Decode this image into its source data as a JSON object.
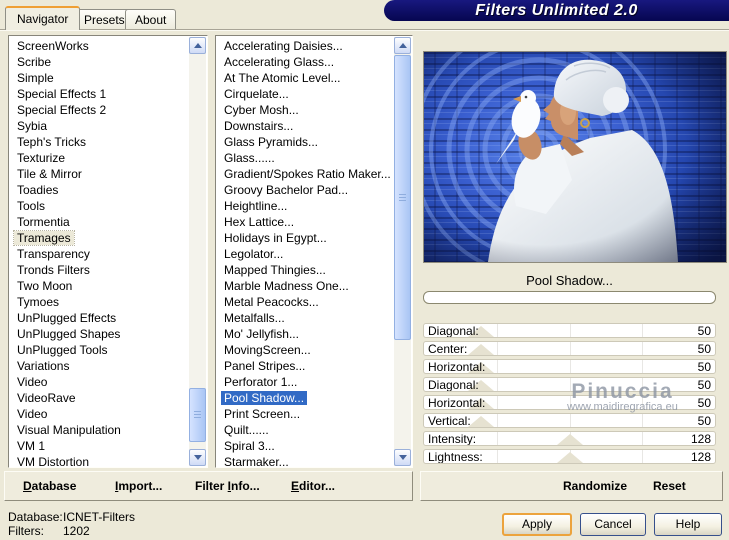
{
  "window": {
    "title": "Filters Unlimited 2.0"
  },
  "tabs": [
    {
      "label": "Navigator",
      "active": true
    },
    {
      "label": "Presets",
      "active": false
    },
    {
      "label": "About",
      "active": false
    }
  ],
  "category_list": {
    "selected_index": 12,
    "items": [
      "ScreenWorks",
      "Scribe",
      "Simple",
      "Special Effects 1",
      "Special Effects 2",
      "Sybia",
      "Teph's Tricks",
      "Texturize",
      "Tile & Mirror",
      "Toadies",
      "Tools",
      "Tormentia",
      "Tramages",
      "Transparency",
      "Tronds Filters",
      "Two Moon",
      "Tymoes",
      "UnPlugged Effects",
      "UnPlugged Shapes",
      "UnPlugged Tools",
      "Variations",
      "Video",
      "VideoRave",
      "Video",
      "Visual Manipulation",
      "VM 1",
      "VM Distortion"
    ]
  },
  "filter_list": {
    "selected_index": 22,
    "items": [
      "Accelerating Daisies...",
      "Accelerating Glass...",
      "At The Atomic Level...",
      "Cirquelate...",
      "Cyber Mosh...",
      "Downstairs...",
      "Glass Pyramids...",
      "Glass......",
      "Gradient/Spokes Ratio Maker...",
      "Groovy Bachelor Pad...",
      "Heightline...",
      "Hex Lattice...",
      "Holidays in Egypt...",
      "Legolator...",
      "Mapped Thingies...",
      "Marble Madness One...",
      "Metal Peacocks...",
      "Metalfalls...",
      "Mo' Jellyfish...",
      "MovingScreen...",
      "Panel Stripes...",
      "Perforator 1...",
      "Pool Shadow...",
      "Print Screen...",
      "Quilt......",
      "Spiral 3...",
      "Starmaker..."
    ]
  },
  "preview": {
    "selected_filter_label": "Pool Shadow...",
    "progress_percent": 0
  },
  "sliders": [
    {
      "label": "Diagonal:",
      "value": 50,
      "max": 255
    },
    {
      "label": "Center:",
      "value": 50,
      "max": 255
    },
    {
      "label": "Horizontal:",
      "value": 50,
      "max": 255
    },
    {
      "label": "Diagonal:",
      "value": 50,
      "max": 255
    },
    {
      "label": "Horizontal:",
      "value": 50,
      "max": 255
    },
    {
      "label": "Vertical:",
      "value": 50,
      "max": 255
    },
    {
      "label": "Intensity:",
      "value": 128,
      "max": 255
    },
    {
      "label": "Lightness:",
      "value": 128,
      "max": 255
    }
  ],
  "watermark": {
    "line1": "Pinuccia",
    "line2": "www.maidiregrafica.eu"
  },
  "menu_bar": {
    "items": [
      {
        "pre": "",
        "key": "D",
        "post": "atabase"
      },
      {
        "pre": "",
        "key": "I",
        "post": "mport..."
      },
      {
        "pre": "Filter ",
        "key": "I",
        "post": "nfo..."
      },
      {
        "pre": "",
        "key": "E",
        "post": "ditor..."
      }
    ]
  },
  "action_bar": {
    "randomize": "Randomize",
    "reset": "Reset"
  },
  "status": {
    "database_label": "Database:",
    "database_value": "ICNET-Filters",
    "filters_label": "Filters:",
    "filters_value": "1202"
  },
  "buttons": {
    "apply": "Apply",
    "cancel": "Cancel",
    "help": "Help"
  },
  "colors": {
    "dialog_bg": "#ece9d8",
    "titlebar": "#0b0b6d",
    "selection": "#316ac5",
    "tab_accent": "#ef9f34",
    "focus_ring": "#eca33c"
  }
}
